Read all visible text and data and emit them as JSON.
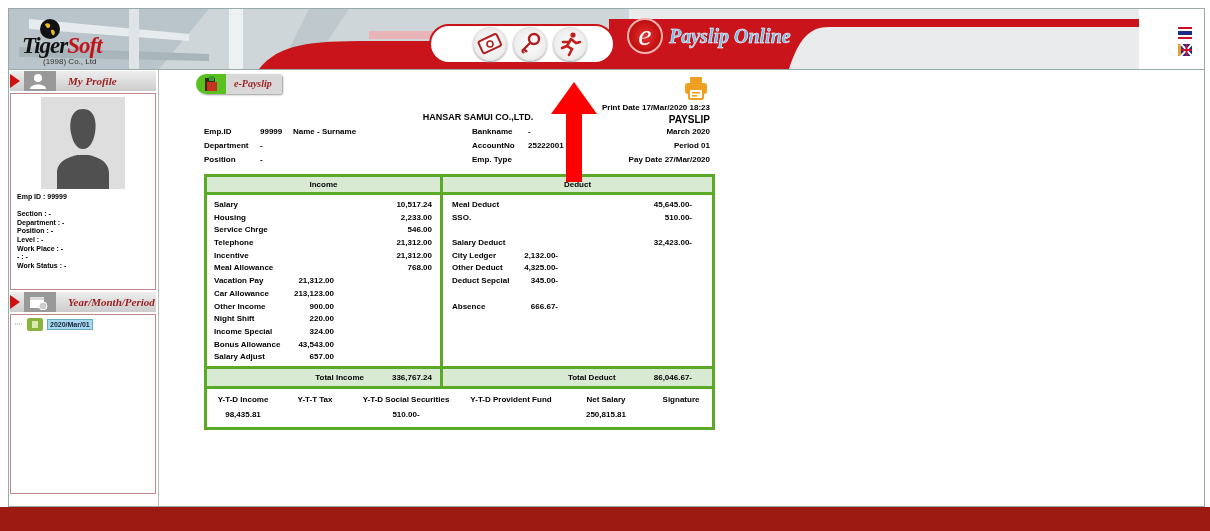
{
  "header": {
    "logo": {
      "name_1": "Tiger",
      "name_2": "Soft",
      "subtitle": "(1998)  Co., Ltd"
    },
    "app_title": {
      "mark": "e",
      "text": "Payslip Online"
    }
  },
  "sidebar": {
    "profile_title": "My Profile",
    "emp_id": "Emp ID : 99999",
    "fields": [
      "Section : -",
      "Department : -",
      "Position : -",
      "Level : -",
      "Work Place : -",
      "- : -",
      "Work Status : -"
    ],
    "period_title": "Year/Month/Period",
    "tree": [
      {
        "label": "2020/Mar/01",
        "selected": true
      }
    ]
  },
  "tab": {
    "label": "e-Payslip",
    "selected": true
  },
  "payslip": {
    "company": "HANSAR SAMUI CO.,LTD.",
    "print_date": "Print Date 17/Mar/2020 18:23",
    "title": "PAYSLIP",
    "info_left": [
      {
        "label": "Emp.ID",
        "value": "99999",
        "extra": "Name - Surname"
      },
      {
        "label": "Department",
        "value": "-"
      },
      {
        "label": "Position",
        "value": "-"
      }
    ],
    "info_middle": [
      {
        "label": "Bankname",
        "value": "-"
      },
      {
        "label": "AccountNo",
        "value": "25222001"
      },
      {
        "label": "Emp. Type"
      }
    ],
    "info_right": [
      "March 2020",
      "Period   01",
      "Pay Date  27/Mar/2020"
    ],
    "income": {
      "title": "Income",
      "items": [
        {
          "label": "Salary",
          "value": "10,517.24",
          "kind": "right"
        },
        {
          "label": "Housing",
          "value": "2,233.00",
          "kind": "right"
        },
        {
          "label": "Service Chrge",
          "value": "546.00",
          "kind": "right"
        },
        {
          "label": "Telephone",
          "value": "21,312.00",
          "kind": "right"
        },
        {
          "label": "Incentive",
          "value": "21,312.00",
          "kind": "right"
        },
        {
          "label": "Meal Allowance",
          "value": "768.00",
          "kind": "right"
        },
        {
          "label": "Vacation Pay",
          "value": "21,312.00",
          "kind": "inline"
        },
        {
          "label": "Car Allowance",
          "value": "213,123.00",
          "kind": "inline"
        },
        {
          "label": "Other Income",
          "value": "900.00",
          "kind": "inline"
        },
        {
          "label": "Night Shift",
          "value": "220.00",
          "kind": "inline"
        },
        {
          "label": "Income Special",
          "value": "324.00",
          "kind": "inline"
        },
        {
          "label": "Bonus Allowance",
          "value": "43,543.00",
          "kind": "inline"
        },
        {
          "label": "Salary Adjust",
          "value": "657.00",
          "kind": "inline"
        }
      ],
      "total_label": "Total Income",
      "total": "336,767.24"
    },
    "deduct": {
      "title": "Deduct",
      "items": [
        {
          "label": "Meal Deduct",
          "value": "45,645.00-",
          "kind": "right"
        },
        {
          "label": "SSO.",
          "value": "510.00-",
          "kind": "right"
        },
        {
          "kind": "blank"
        },
        {
          "label": "Salary Deduct",
          "value": "32,423.00-",
          "kind": "right"
        },
        {
          "label": "City Ledger",
          "value": "2,132.00-",
          "kind": "inline"
        },
        {
          "label": "Other Deduct",
          "value": "4,325.00-",
          "kind": "inline"
        },
        {
          "label": "Deduct Sepcial",
          "value": "345.00-",
          "kind": "inline"
        },
        {
          "kind": "blank"
        },
        {
          "label": "Absence",
          "value": "666.67-",
          "kind": "inline"
        }
      ],
      "total_label": "Total Deduct",
      "total": "86,046.67-"
    },
    "summary": [
      {
        "label": "Y-T-D Income",
        "value": "98,435.81"
      },
      {
        "label": "Y-T-T Tax"
      },
      {
        "label": "Y-T-D Social Securities",
        "value": "510.00-"
      },
      {
        "label": "Y-T-D Provident Fund"
      },
      {
        "label": "Net Salary",
        "value": "250,815.81"
      },
      {
        "label": "Signature"
      }
    ]
  },
  "annotation": {
    "kind": "arrow"
  }
}
